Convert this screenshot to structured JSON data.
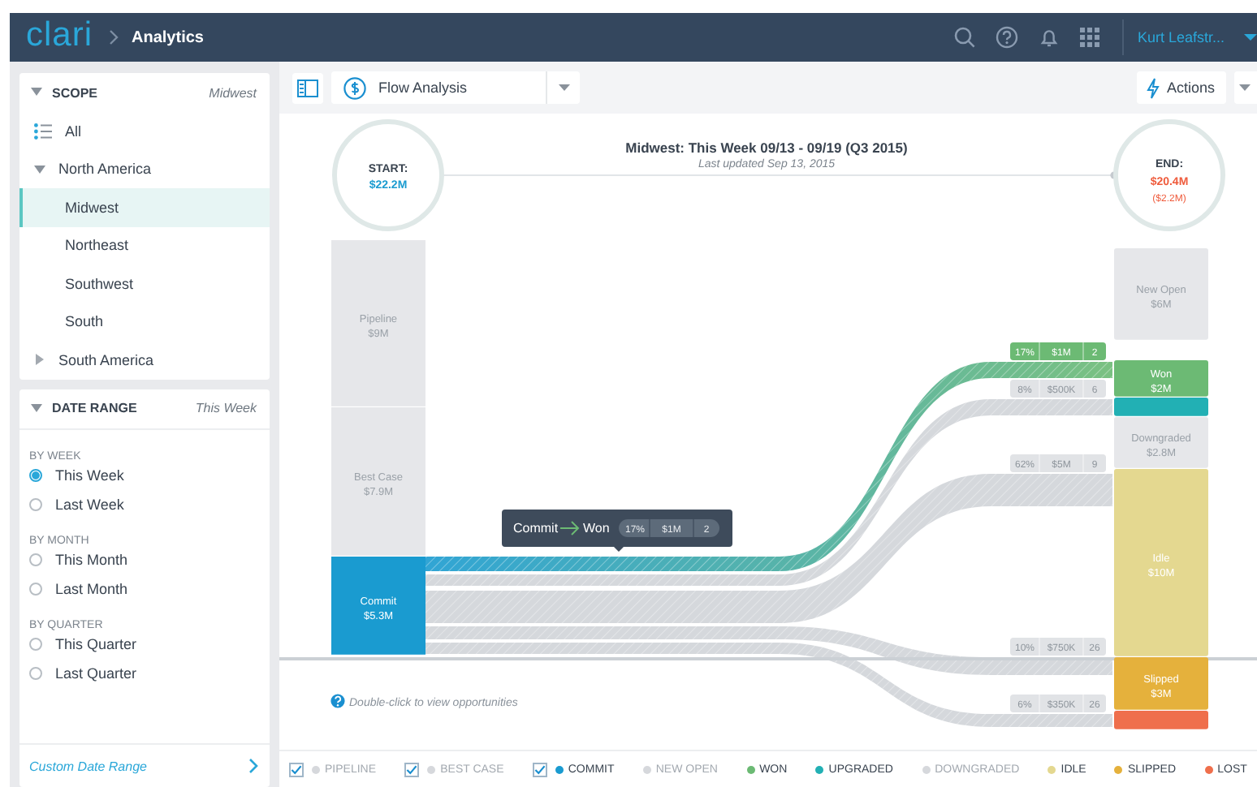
{
  "header": {
    "logo": "clari",
    "section": "Analytics",
    "user": "Kurt Leafstr..."
  },
  "scope": {
    "title": "SCOPE",
    "value": "Midwest",
    "items": [
      {
        "label": "All",
        "kind": "all",
        "selected": false
      },
      {
        "label": "North America",
        "kind": "group",
        "selected": false,
        "expanded": true,
        "children": [
          {
            "label": "Midwest",
            "selected": true
          },
          {
            "label": "Northeast",
            "selected": false
          },
          {
            "label": "Southwest",
            "selected": false
          },
          {
            "label": "South",
            "selected": false
          }
        ]
      },
      {
        "label": "South America",
        "kind": "group",
        "selected": false,
        "expanded": false
      }
    ]
  },
  "date_range": {
    "title": "DATE RANGE",
    "value": "This Week",
    "groups": [
      {
        "heading": "BY WEEK",
        "options": [
          {
            "label": "This Week",
            "selected": true
          },
          {
            "label": "Last Week",
            "selected": false
          }
        ]
      },
      {
        "heading": "BY MONTH",
        "options": [
          {
            "label": "This Month",
            "selected": false
          },
          {
            "label": "Last Month",
            "selected": false
          }
        ]
      },
      {
        "heading": "BY QUARTER",
        "options": [
          {
            "label": "This Quarter",
            "selected": false
          },
          {
            "label": "Last Quarter",
            "selected": false
          }
        ]
      }
    ],
    "custom_link": "Custom Date Range"
  },
  "toolbar": {
    "view": "Flow Analysis",
    "actions": "Actions"
  },
  "flow": {
    "title": "Midwest: This Week 09/13 - 09/19 (Q3 2015)",
    "subtitle": "Last updated Sep 13, 2015",
    "start": {
      "label": "START:",
      "value": "$22.2M"
    },
    "end": {
      "label": "END:",
      "value": "$20.4M",
      "change": "($2.2M)"
    },
    "sources": [
      {
        "label": "Pipeline",
        "value": "$9M",
        "selected": false
      },
      {
        "label": "Best Case",
        "value": "$7.9M",
        "selected": false
      },
      {
        "label": "Commit",
        "value": "$5.3M",
        "selected": true
      }
    ],
    "outcomes": [
      {
        "label": "New Open",
        "value": "$6M",
        "color": "#e6e7ea"
      },
      {
        "label": "Won",
        "value": "$2M",
        "color": "#6cba74"
      },
      {
        "color": "#22b0b4"
      },
      {
        "label": "Downgraded",
        "value": "$2.8M",
        "color": "#e6e7ea"
      },
      {
        "label": "Idle",
        "value": "$10M",
        "color": "#e4d890"
      },
      {
        "label": "Slipped",
        "value": "$3M",
        "color": "#e5b13c"
      },
      {
        "color": "#ef6f4c"
      }
    ],
    "flows": [
      {
        "pct": "17%",
        "amount": "$1M",
        "count": "2",
        "highlighted": true
      },
      {
        "pct": "8%",
        "amount": "$500K",
        "count": "6",
        "highlighted": false
      },
      {
        "pct": "62%",
        "amount": "$5M",
        "count": "9",
        "highlighted": false
      },
      {
        "pct": "10%",
        "amount": "$750K",
        "count": "26",
        "highlighted": false
      },
      {
        "pct": "6%",
        "amount": "$350K",
        "count": "26",
        "highlighted": false
      }
    ],
    "tooltip": {
      "from": "Commit",
      "to": "Won",
      "pct": "17%",
      "amount": "$1M",
      "count": "2"
    },
    "hint": "Double-click to view opportunities"
  },
  "legend": {
    "toggles": [
      {
        "label": "PIPELINE",
        "checked": true,
        "dimmed": true,
        "color": "#d6d8dc"
      },
      {
        "label": "BEST CASE",
        "checked": true,
        "dimmed": true,
        "color": "#d6d8dc"
      },
      {
        "label": "COMMIT",
        "checked": true,
        "dimmed": false,
        "color": "#1a9bd0"
      }
    ],
    "items": [
      {
        "label": "NEW OPEN",
        "dimmed": true,
        "color": "#d6d8dc"
      },
      {
        "label": "WON",
        "dimmed": false,
        "color": "#6cba74"
      },
      {
        "label": "UPGRADED",
        "dimmed": false,
        "color": "#22b0b4"
      },
      {
        "label": "DOWNGRADED",
        "dimmed": true,
        "color": "#d6d8dc"
      },
      {
        "label": "IDLE",
        "dimmed": false,
        "color": "#e4d890"
      },
      {
        "label": "SLIPPED",
        "dimmed": false,
        "color": "#e5b13c"
      },
      {
        "label": "LOST",
        "dimmed": false,
        "color": "#ef6f4c"
      }
    ]
  }
}
